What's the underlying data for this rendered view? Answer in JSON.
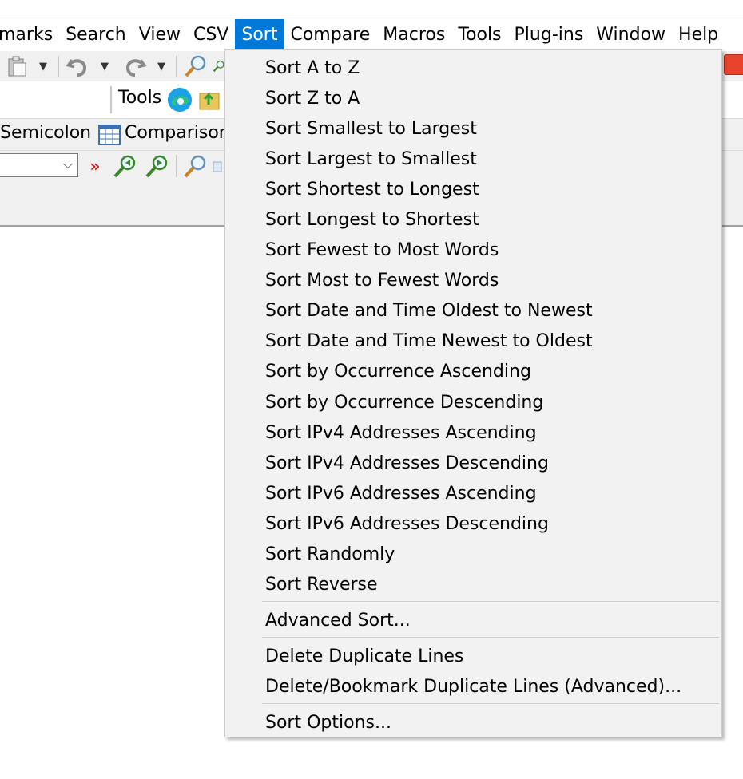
{
  "menubar": {
    "items": [
      {
        "label": "marks",
        "name": "menu-bookmarks"
      },
      {
        "label": "Search",
        "name": "menu-search"
      },
      {
        "label": "View",
        "name": "menu-view"
      },
      {
        "label": "CSV",
        "name": "menu-csv"
      },
      {
        "label": "Sort",
        "name": "menu-sort"
      },
      {
        "label": "Compare",
        "name": "menu-compare"
      },
      {
        "label": "Macros",
        "name": "menu-macros"
      },
      {
        "label": "Tools",
        "name": "menu-tools"
      },
      {
        "label": "Plug-ins",
        "name": "menu-plugins"
      },
      {
        "label": "Window",
        "name": "menu-window"
      },
      {
        "label": "Help",
        "name": "menu-help"
      }
    ],
    "active_label": "Sort"
  },
  "toolbar": {
    "tools_label": "Tools",
    "semicolon_label": "Semicolon",
    "comparison_label": "Comparison"
  },
  "icons": {
    "paste": "paste-icon",
    "undo": "undo-icon",
    "redo": "redo-icon",
    "find": "find-icon",
    "edge": "edge-browser-icon",
    "folder_up": "folder-up-icon",
    "comparison": "table-icon",
    "expand": "double-chevron-icon",
    "find_next": "find-next-icon",
    "find_prev": "find-previous-icon"
  },
  "colors": {
    "menu_highlight": "#0078d7",
    "menu_background": "#f2f2f2",
    "toolbar_background": "#f0f0f0"
  },
  "sort_menu": {
    "group1": [
      "Sort A to Z",
      "Sort Z to A",
      "Sort Smallest to Largest",
      "Sort Largest to Smallest",
      "Sort Shortest to Longest",
      "Sort Longest to Shortest",
      "Sort Fewest to Most Words",
      "Sort Most to Fewest Words",
      "Sort Date and Time Oldest to Newest",
      "Sort Date and Time Newest to Oldest",
      "Sort by Occurrence Ascending",
      "Sort by Occurrence Descending",
      "Sort IPv4 Addresses Ascending",
      "Sort IPv4 Addresses Descending",
      "Sort IPv6 Addresses Ascending",
      "Sort IPv6 Addresses Descending",
      "Sort Randomly",
      "Sort Reverse"
    ],
    "advanced": "Advanced Sort...",
    "delete_duplicates": "Delete Duplicate Lines",
    "delete_bookmark_duplicates": "Delete/Bookmark Duplicate Lines (Advanced)...",
    "options": "Sort Options..."
  }
}
